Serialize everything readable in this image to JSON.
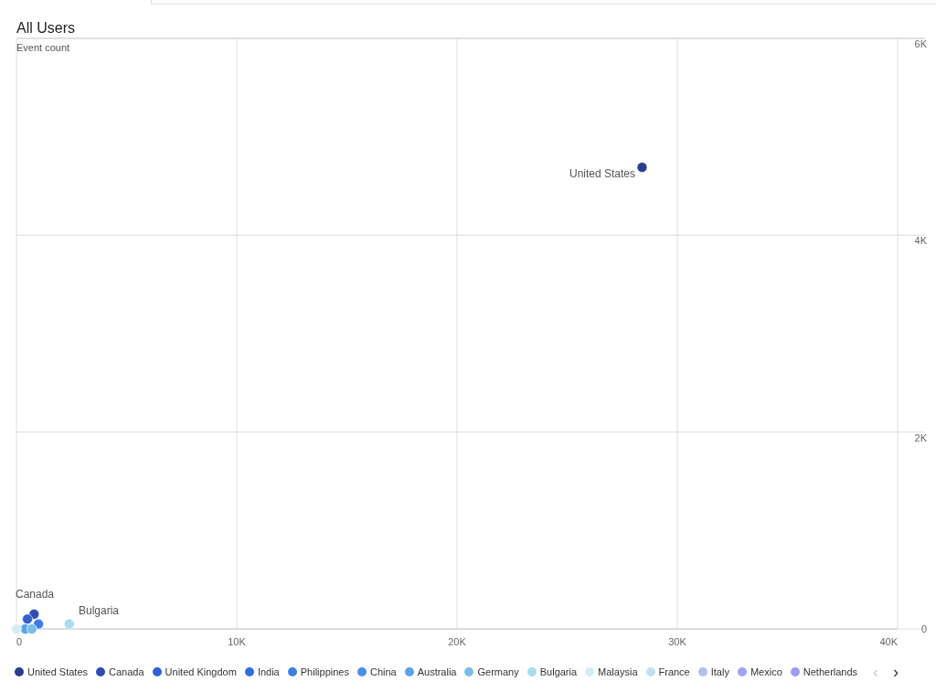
{
  "title": "All Users",
  "chart": {
    "chart_data": {
      "type": "scatter",
      "ylabel": "Event count",
      "xlim": [
        0,
        40000
      ],
      "ylim": [
        0,
        6000
      ],
      "xticks": [
        {
          "value": 0,
          "label": "0"
        },
        {
          "value": 10000,
          "label": "10K"
        },
        {
          "value": 20000,
          "label": "20K"
        },
        {
          "value": 30000,
          "label": "30K"
        },
        {
          "value": 40000,
          "label": "40K"
        }
      ],
      "yticks": [
        {
          "value": 0,
          "label": "0"
        },
        {
          "value": 2000,
          "label": "2K"
        },
        {
          "value": 4000,
          "label": "4K"
        },
        {
          "value": 6000,
          "label": "6K"
        }
      ],
      "series": [
        {
          "name": "United States",
          "color": "#2a3f8f",
          "x": [
            28400
          ],
          "values": [
            4690
          ]
        },
        {
          "name": "Canada",
          "color": "#2f4fb0",
          "x": [
            800
          ],
          "values": [
            150
          ]
        },
        {
          "name": "United Kingdom",
          "color": "#3361d0",
          "x": [
            500
          ],
          "values": [
            100
          ]
        },
        {
          "name": "India",
          "color": "#2f6ee0",
          "x": [
            null
          ],
          "values": [
            null
          ]
        },
        {
          "name": "Philippines",
          "color": "#3d7ee6",
          "x": [
            1000
          ],
          "values": [
            50
          ]
        },
        {
          "name": "China",
          "color": "#4a90e8",
          "x": [
            null
          ],
          "values": [
            null
          ]
        },
        {
          "name": "Australia",
          "color": "#5aa3ec",
          "x": [
            400
          ],
          "values": [
            0
          ]
        },
        {
          "name": "Germany",
          "color": "#7bbde8",
          "x": [
            700
          ],
          "values": [
            0
          ]
        },
        {
          "name": "Bulgaria",
          "color": "#a9dcf0",
          "x": [
            2400
          ],
          "values": [
            50
          ]
        },
        {
          "name": "Malaysia",
          "color": "#d4ecf5",
          "x": [
            0
          ],
          "values": [
            0
          ]
        },
        {
          "name": "France",
          "color": "#c0ddf2"
        },
        {
          "name": "Italy",
          "color": "#b0c0f0"
        },
        {
          "name": "Mexico",
          "color": "#9fa6ee"
        },
        {
          "name": "Netherlands",
          "color": "#9b9cf2"
        }
      ],
      "grid": true,
      "annotations": [
        {
          "text": "United States"
        },
        {
          "text": "Canada"
        },
        {
          "text": "Bulgaria"
        }
      ]
    }
  },
  "legend_nav": [
    {
      "label": "‹",
      "disabled": true
    },
    {
      "label": "›",
      "disabled": false
    }
  ]
}
